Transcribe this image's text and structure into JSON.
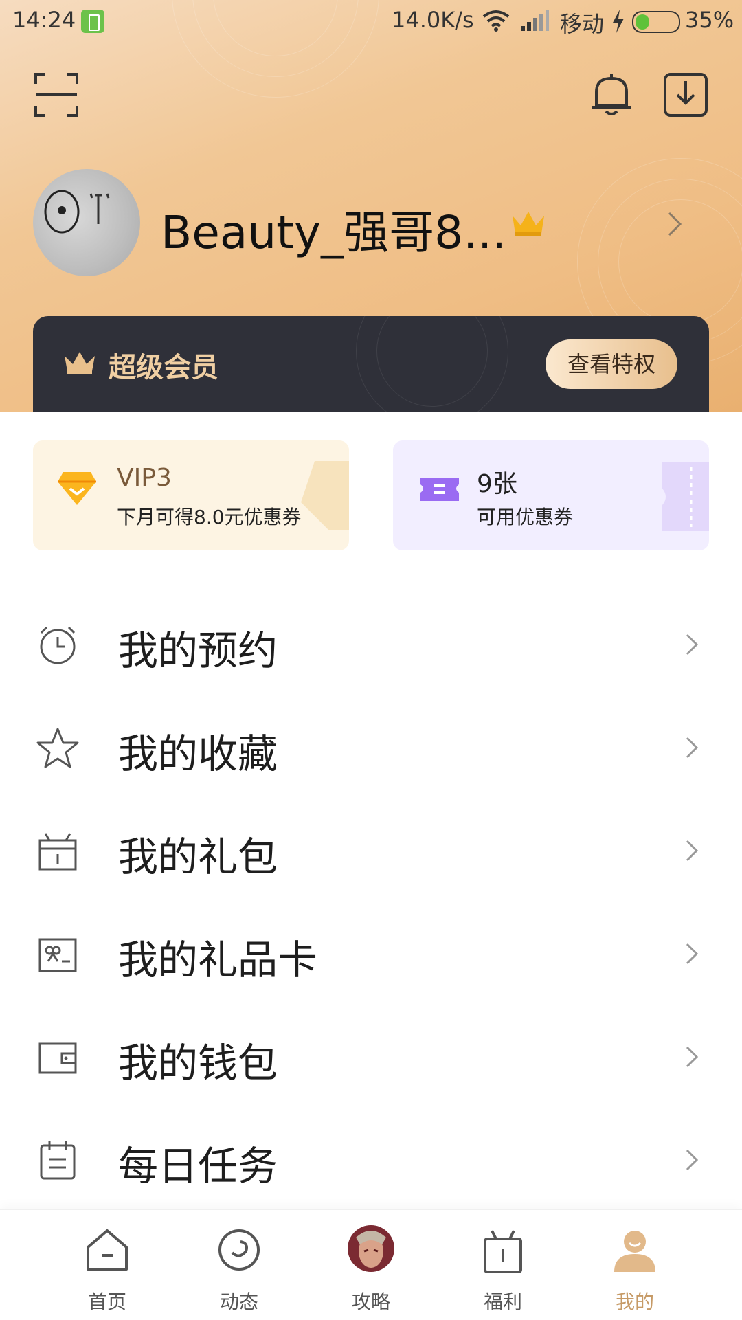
{
  "status_bar": {
    "time": "14:24",
    "net_speed": "14.0K/s",
    "carrier": "移动",
    "battery_pct": "35%",
    "battery_level": 0.35
  },
  "header": {
    "scan_icon": "scan-icon",
    "bell_icon": "bell-icon",
    "download_icon": "download-icon"
  },
  "profile": {
    "username": "Beauty_强哥8..."
  },
  "vip_banner": {
    "title": "超级会员",
    "button": "查看特权"
  },
  "promos": [
    {
      "title": "VIP3",
      "subtitle": "下月可得8.0元优惠券"
    },
    {
      "title": "9张",
      "subtitle": "可用优惠券"
    }
  ],
  "menu": [
    {
      "label": "我的预约",
      "icon": "alarm-clock-icon"
    },
    {
      "label": "我的收藏",
      "icon": "star-icon"
    },
    {
      "label": "我的礼包",
      "icon": "gift-box-icon"
    },
    {
      "label": "我的礼品卡",
      "icon": "gift-card-icon"
    },
    {
      "label": "我的钱包",
      "icon": "wallet-icon"
    },
    {
      "label": "每日任务",
      "icon": "calendar-task-icon"
    }
  ],
  "tabs": [
    {
      "label": "首页",
      "icon": "home-icon"
    },
    {
      "label": "动态",
      "icon": "moments-icon"
    },
    {
      "label": "攻略",
      "icon": "game-avatar-icon"
    },
    {
      "label": "福利",
      "icon": "gift-icon"
    },
    {
      "label": "我的",
      "icon": "profile-icon",
      "active": true
    }
  ],
  "colors": {
    "accent": "#c69a66",
    "vip_card_bg": "#2f3039",
    "vip_gold": "#f0cfa3"
  }
}
